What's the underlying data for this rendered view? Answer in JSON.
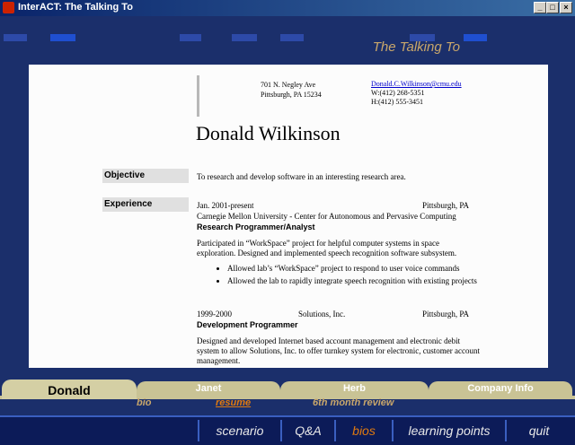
{
  "window": {
    "title": "InterACT: The Talking To",
    "min": "_",
    "max": "□",
    "close": "×"
  },
  "header": {
    "title": "The Talking To"
  },
  "resume": {
    "address_line1": "701 N. Negley Ave",
    "address_line2": "Pittsburgh, PA 15234",
    "email": "Donald.C.Wilkinson@cmu.edu",
    "work_phone": "W:(412) 268-5351",
    "home_phone": "H:(412) 555-3451",
    "name": "Donald Wilkinson",
    "objective_label": "Objective",
    "objective_text": "To research and develop software in an interesting research area.",
    "experience_label": "Experience",
    "job1": {
      "dates": "Jan. 2001-present",
      "location": "Pittsburgh, PA",
      "org": "Carnegie Mellon University - Center for Autonomous and Pervasive Computing",
      "title": "Research Programmer/Analyst",
      "desc": "Participated in “WorkSpace” project for helpful computer systems in space exploration.  Designed and implemented speech recognition software subsystem.",
      "bullets": [
        "Allowed lab’s “WorkSpace” project to respond to user voice commands",
        "Allowed the lab to rapidly integrate speech recognition with existing projects"
      ]
    },
    "job2": {
      "dates": "1999-2000",
      "company": "Solutions, Inc.",
      "location": "Pittsburgh, PA",
      "title": "Development Programmer",
      "desc": "Designed and developed Internet based account management and electronic debit system to allow Solutions, Inc. to offer turnkey system for electronic, customer account management."
    }
  },
  "person_tabs": [
    "Donald",
    "Janet",
    "Herb",
    "Company Info"
  ],
  "sub_tabs": [
    "bio",
    "resume",
    "6th month review"
  ],
  "nav": [
    "scenario",
    "Q&A",
    "bios",
    "learning points",
    "quit"
  ]
}
